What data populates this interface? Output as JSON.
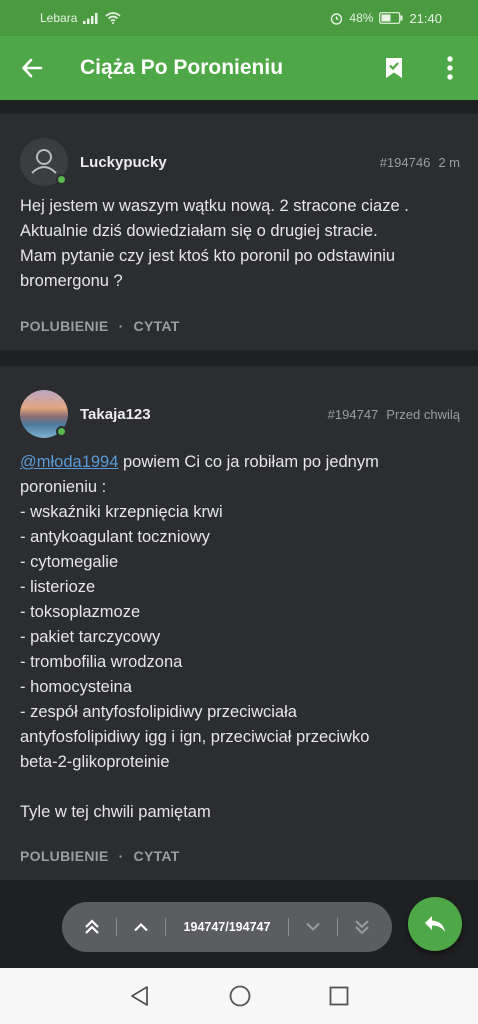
{
  "status_bar": {
    "carrier": "Lebara",
    "battery": "48%",
    "time": "21:40"
  },
  "app_bar": {
    "title": "Ciąża Po Poronieniu"
  },
  "posts": [
    {
      "username": "Luckypucky",
      "post_id": "#194746",
      "time": "2 m",
      "body": [
        "Hej jestem w waszym wątku nową. 2 stracone ciaze .",
        "Aktualnie dziś dowiedziałam się o drugiej stracie.",
        "Mam pytanie czy jest ktoś kto poronil po odstawiniu",
        "bromergonu ?"
      ],
      "like_label": "POLUBIENIE",
      "quote_label": "CYTAT"
    },
    {
      "username": "Takaja123",
      "post_id": "#194747",
      "time": "Przed chwilą",
      "mention": "@młoda1994",
      "body_first_line_rest": " powiem Ci co ja robiłam po jednym",
      "body": [
        "poronieniu :",
        "- wskaźniki krzepnięcia krwi",
        "- antykoagulant toczniowy",
        "- cytomegalie",
        "- listerioze",
        "- toksoplazmoze",
        "- pakiet tarczycowy",
        "- trombofilia wrodzona",
        "- homocysteina",
        "- zespół antyfosfolipidiwy przeciwciała",
        "antyfosfolipidiwy igg i ign, przeciwciał przeciwko",
        "beta-2-glikoproteinie",
        "",
        "Tyle w tej chwili pamiętam"
      ],
      "like_label": "POLUBIENIE",
      "quote_label": "CYTAT"
    }
  ],
  "pager": {
    "position": "194747/194747"
  },
  "icons": {
    "back": "arrow-left-icon",
    "bookmark": "bookmark-check-icon",
    "menu": "more-vertical-icon",
    "reply": "reply-icon",
    "default_avatar": "person-icon"
  },
  "colors": {
    "accent": "#4fa847",
    "online": "#58b84c",
    "mention": "#5b9bd5"
  }
}
